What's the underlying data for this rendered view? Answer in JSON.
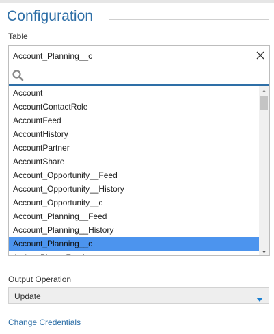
{
  "section": {
    "title": "Configuration"
  },
  "table_field": {
    "label": "Table",
    "selected_value": "Account_Planning__c",
    "search_placeholder": "",
    "items": [
      "Account",
      "AccountContactRole",
      "AccountFeed",
      "AccountHistory",
      "AccountPartner",
      "AccountShare",
      "Account_Opportunity__Feed",
      "Account_Opportunity__History",
      "Account_Opportunity__c",
      "Account_Planning__Feed",
      "Account_Planning__History",
      "Account_Planning__c",
      "Action_Plan__Feed"
    ],
    "selected_index": 11
  },
  "output_operation": {
    "label": "Output Operation",
    "value": "Update"
  },
  "change_credentials": {
    "label": "Change Credentials"
  },
  "colors": {
    "accent": "#2e6fa7",
    "selection": "#4c94ee",
    "caret": "#1a7fd1"
  }
}
